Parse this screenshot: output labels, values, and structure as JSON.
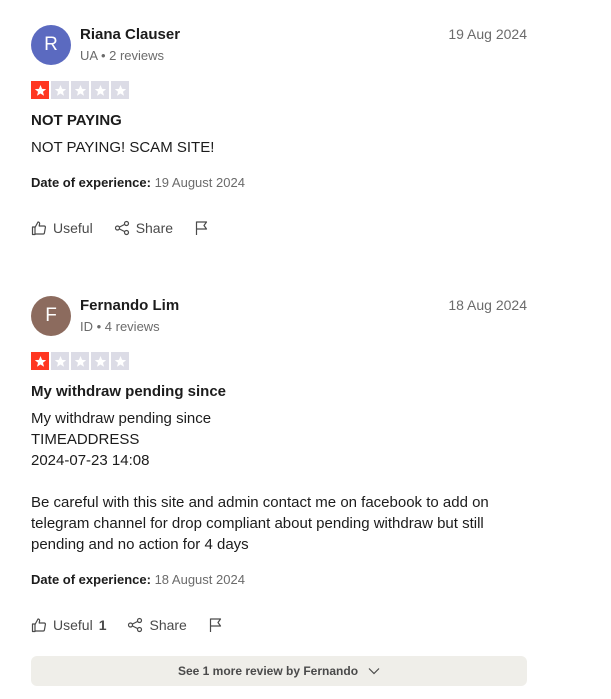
{
  "colors": {
    "star_filled": "#ff3722",
    "star_empty": "#dcdce6",
    "avatar_1": "#5b6ac0",
    "avatar_2": "#8c6b5e"
  },
  "reviews": [
    {
      "avatar_initial": "R",
      "name": "Riana Clauser",
      "meta": "UA • 2 reviews",
      "date": "19 Aug 2024",
      "rating": 1,
      "title": "NOT PAYING",
      "body": "NOT PAYING! SCAM SITE!",
      "experience_label": "Date of experience:",
      "experience_date": "19 August 2024",
      "useful_label": "Useful",
      "useful_count": "",
      "share_label": "Share",
      "flag_icon": "flag-icon"
    },
    {
      "avatar_initial": "F",
      "name": "Fernando Lim",
      "meta": "ID • 4 reviews",
      "date": "18 Aug 2024",
      "rating": 1,
      "title": "My withdraw pending since",
      "body": "My withdraw pending since\nTIMEADDRESS\n2024-07-23 14:08\n\nBe careful with this site and admin contact me on facebook to add on telegram channel for drop compliant about pending withdraw but still pending and no action for 4 days",
      "experience_label": "Date of experience:",
      "experience_date": "18 August 2024",
      "useful_label": "Useful",
      "useful_count": "1",
      "share_label": "Share",
      "flag_icon": "flag-icon"
    }
  ],
  "see_more_label": "See 1 more review by Fernando"
}
